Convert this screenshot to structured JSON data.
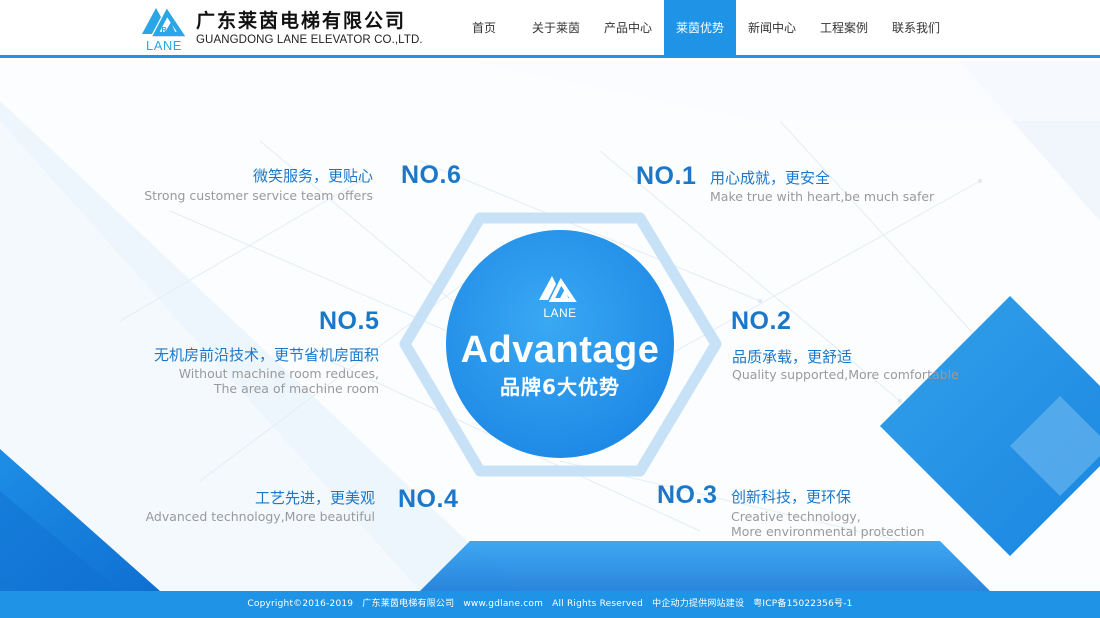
{
  "header": {
    "logo_text": "LANE",
    "company_cn": "广东莱茵电梯有限公司",
    "company_en": "GUANGDONG LANE ELEVATOR CO.,LTD.",
    "nav": [
      {
        "label": "首页",
        "active": false
      },
      {
        "label": "关于莱茵",
        "active": false
      },
      {
        "label": "产品中心",
        "active": false
      },
      {
        "label": "莱茵优势",
        "active": true
      },
      {
        "label": "新闻中心",
        "active": false
      },
      {
        "label": "工程案例",
        "active": false
      },
      {
        "label": "联系我们",
        "active": false
      }
    ]
  },
  "center": {
    "logo_text": "LANE",
    "title_en": "Advantage",
    "title_cn": "品牌6大优势"
  },
  "advantages": {
    "no1": {
      "no": "NO.1",
      "title": "用心成就，更安全",
      "desc": [
        "Make true with heart,be much safer"
      ]
    },
    "no2": {
      "no": "NO.2",
      "title": "品质承载，更舒适",
      "desc": [
        "Quality supported,More comfortable"
      ]
    },
    "no3": {
      "no": "NO.3",
      "title": "创新科技，更环保",
      "desc": [
        "Creative technology,",
        "More environmental protection"
      ]
    },
    "no4": {
      "no": "NO.4",
      "title": "工艺先进，更美观",
      "desc": [
        "Advanced technology,More beautiful"
      ]
    },
    "no5": {
      "no": "NO.5",
      "title": "无机房前沿技术，更节省机房面积",
      "desc": [
        "Without machine room reduces,",
        "The area of machine room"
      ]
    },
    "no6": {
      "no": "NO.6",
      "title": "微笑服务，更贴心",
      "desc": [
        "Strong customer service team offers"
      ]
    }
  },
  "footer": {
    "copyright": "Copyright©2016-2019",
    "company": "广东莱茵电梯有限公司",
    "site": "www.gdlane.com",
    "rights": "All Rights Reserved",
    "provider": "中企动力提供网站建设",
    "icp": "粤ICP备15022356号-1"
  },
  "colors": {
    "brand": "#1f94e6",
    "heading": "#1b78c9",
    "muted": "#9a9a9a",
    "logo": "#2aa5e6"
  }
}
